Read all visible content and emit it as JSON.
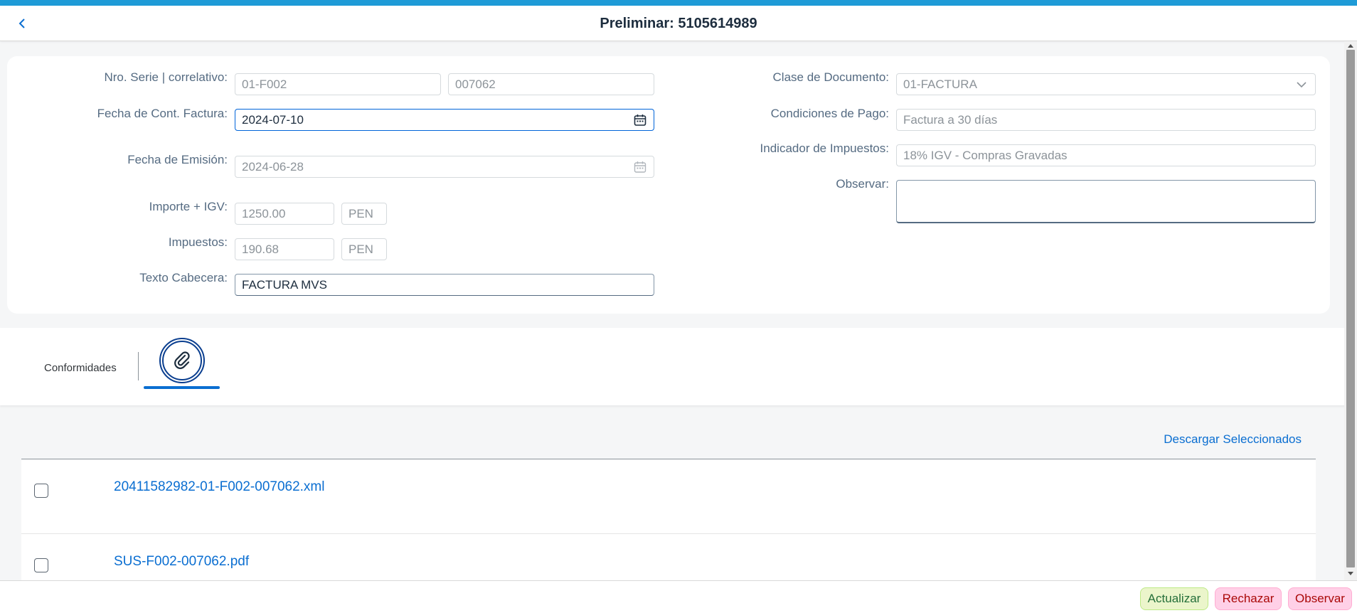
{
  "header": {
    "title": "Preliminar: 5105614989",
    "back_icon": "chevron-left-icon"
  },
  "form": {
    "serie_label": "Nro. Serie | correlativo:",
    "serie_value": "01-F002",
    "correlativo_value": "007062",
    "fecha_cont_label": "Fecha de Cont. Factura:",
    "fecha_cont_value": "2024-07-10",
    "fecha_emision_label": "Fecha de Emisión:",
    "fecha_emision_value": "2024-06-28",
    "importe_label": "Importe + IGV:",
    "importe_value": "1250.00",
    "importe_currency": "PEN",
    "impuestos_label": "Impuestos:",
    "impuestos_value": "190.68",
    "impuestos_currency": "PEN",
    "texto_label": "Texto Cabecera:",
    "texto_value": "FACTURA MVS",
    "clase_label": "Clase de Documento:",
    "clase_value": "01-FACTURA",
    "condiciones_label": "Condiciones de Pago:",
    "condiciones_value": "Factura a 30 días",
    "indicador_label": "Indicador de Impuestos:",
    "indicador_value": "18% IGV - Compras Gravadas",
    "observar_label": "Observar:",
    "observar_value": ""
  },
  "tabs": {
    "conformidades_label": "Conformidades",
    "attachments_icon": "paperclip-icon",
    "selected": "attachments"
  },
  "attachments": {
    "download_label": "Descargar Seleccionados",
    "files": [
      {
        "name": "20411582982-01-F002-007062.xml",
        "checked": false
      },
      {
        "name": "SUS-F002-007062.pdf",
        "checked": false
      }
    ]
  },
  "footer": {
    "update_label": "Actualizar",
    "reject_label": "Rechazar",
    "observe_label": "Observar"
  },
  "colors": {
    "accent": "#0a6ed1",
    "topbar": "#1e9bd7",
    "accept_bg": "#ebf5cb",
    "reject_bg": "#ffd0e7"
  }
}
